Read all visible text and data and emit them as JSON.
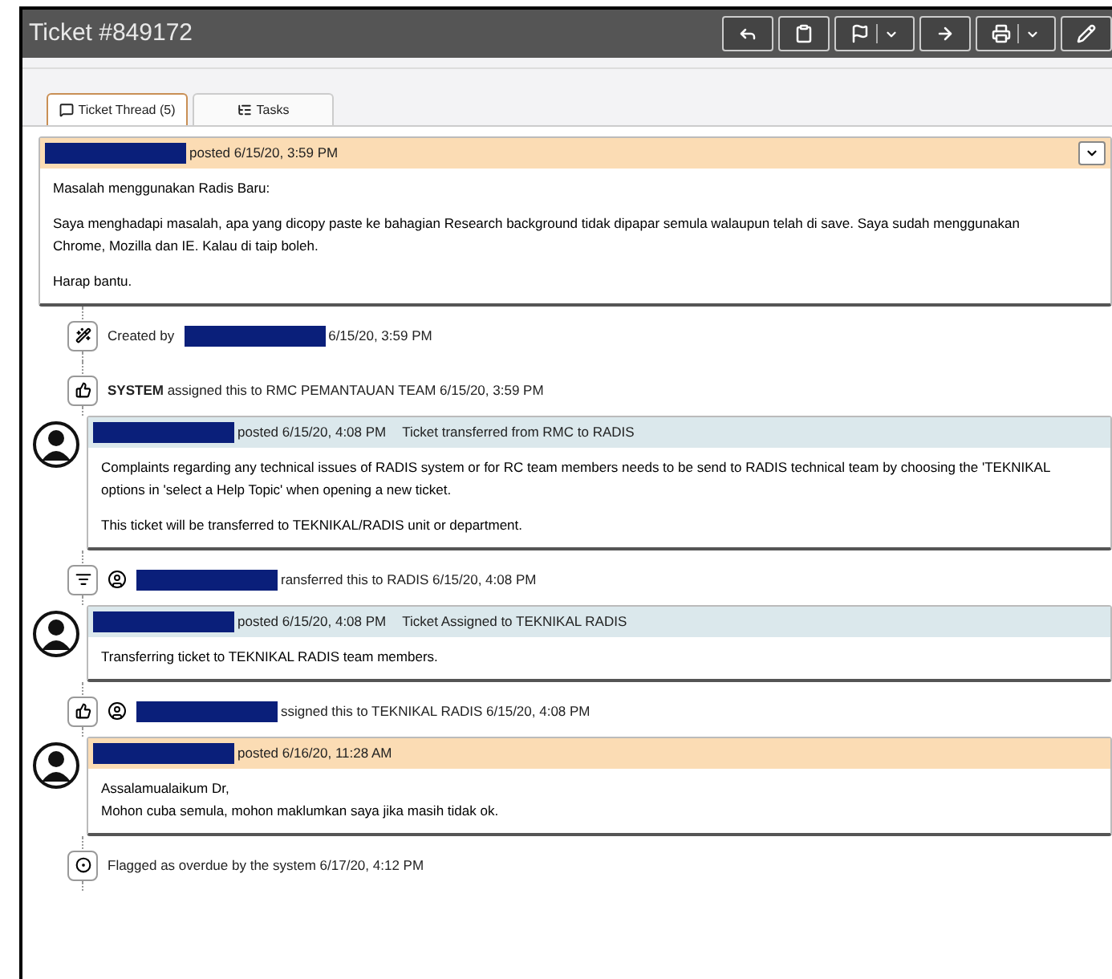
{
  "window": {
    "title": "Ticket #849172"
  },
  "toolbar": [
    {
      "kind": "reply",
      "caret": false
    },
    {
      "kind": "clipboard",
      "caret": false
    },
    {
      "kind": "flag",
      "caret": true
    },
    {
      "kind": "transfer",
      "caret": false
    },
    {
      "kind": "print",
      "caret": true
    },
    {
      "kind": "edit",
      "caret": false
    }
  ],
  "tabs": [
    {
      "kind": "thread",
      "label": "Ticket Thread (5)",
      "selected": true
    },
    {
      "kind": "tasks",
      "label": "Tasks",
      "selected": false
    }
  ],
  "thread": [
    {
      "kind": "customer_post",
      "avatar": false,
      "expand_button": true,
      "posted": "posted 6/15/20, 3:59 PM",
      "paragraphs": [
        [
          "Masalah menggunakan Radis Baru:"
        ],
        [
          "Saya menghadapi masalah, apa yang dicopy paste ke bahagian Research background tidak dipapar semula walaupun telah di save. Saya sudah menggunakan",
          "Chrome, Mozilla dan IE. Kalau di taip boleh."
        ],
        [
          "Harap bantu."
        ]
      ]
    },
    {
      "kind": "created",
      "parts": [
        {
          "kind": "text",
          "text": "Created by"
        },
        {
          "kind": "redacted"
        },
        {
          "kind": "text",
          "text": "6/15/20, 3:59 PM"
        }
      ]
    },
    {
      "kind": "assigned",
      "parts": [
        {
          "kind": "text",
          "text": "**SYSTEM** assigned this to RMC PEMANTAUAN TEAM 6/15/20, 3:59 PM"
        }
      ]
    },
    {
      "kind": "staff_post",
      "avatar": true,
      "expand_button": false,
      "posted": "posted 6/15/20, 4:08 PM",
      "title": "Ticket transferred from RMC to RADIS",
      "paragraphs": [
        [
          "Complaints regarding any technical issues of RADIS system or for RC team members needs to be send to RADIS technical team by choosing the 'TEKNIKAL",
          "options in 'select a Help Topic' when opening a new ticket."
        ],
        [
          "This ticket will be transferred to TEKNIKAL/RADIS unit or department."
        ]
      ]
    },
    {
      "kind": "transferred",
      "parts": [
        {
          "kind": "user_icon"
        },
        {
          "kind": "redacted"
        },
        {
          "kind": "text",
          "text": "ransferred this to RADIS 6/15/20, 4:08 PM"
        }
      ]
    },
    {
      "kind": "staff_post",
      "avatar": true,
      "expand_button": false,
      "posted": "posted 6/15/20, 4:08 PM",
      "title": "Ticket Assigned to TEKNIKAL RADIS",
      "paragraphs": [
        [
          "Transferring ticket to TEKNIKAL RADIS team members."
        ]
      ]
    },
    {
      "kind": "assigned",
      "parts": [
        {
          "kind": "user_icon"
        },
        {
          "kind": "redacted"
        },
        {
          "kind": "text",
          "text": "ssigned this to TEKNIKAL RADIS 6/15/20, 4:08 PM"
        }
      ]
    },
    {
      "kind": "customer_post",
      "avatar": true,
      "expand_button": false,
      "posted": "posted 6/16/20, 11:28 AM",
      "paragraphs": [
        [
          "Assalamualaikum Dr,",
          "Mohon cuba semula, mohon maklumkan saya jika masih tidak ok."
        ]
      ]
    },
    {
      "kind": "overdue",
      "parts": [
        {
          "kind": "text",
          "text": "Flagged as overdue by the system 6/17/20, 4:12 PM"
        }
      ]
    }
  ]
}
